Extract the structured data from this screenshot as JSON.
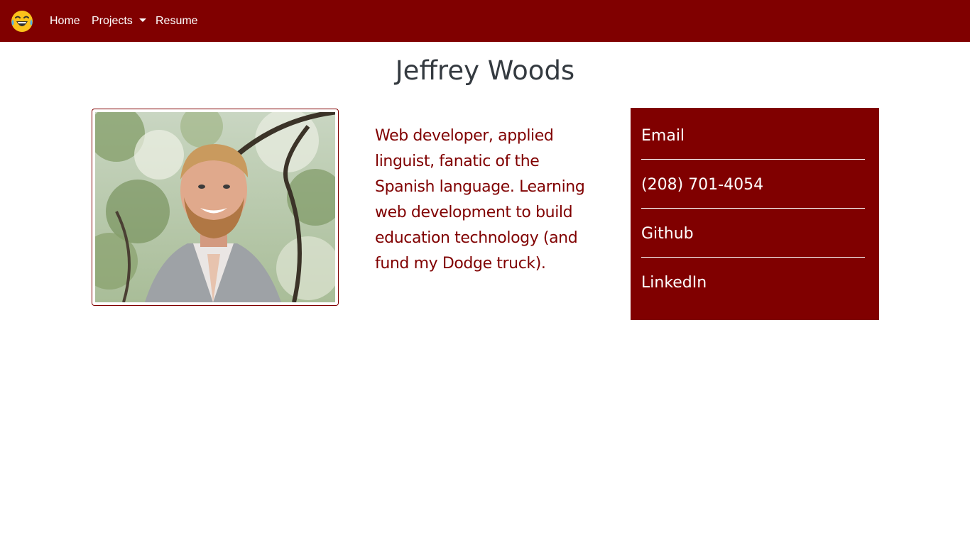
{
  "brand": {
    "icon": "laughing-face-emoji"
  },
  "nav": {
    "home_label": "Home",
    "projects_label": "Projects",
    "resume_label": "Resume"
  },
  "page": {
    "title": "Jeffrey Woods",
    "bio": "Web developer, applied linguist, fanatic of the Spanish language. Learning web development to build education technology (and fund my Dodge truck)."
  },
  "contact": {
    "items": [
      {
        "label": "Email"
      },
      {
        "label": "(208) 701-4054"
      },
      {
        "label": "Github"
      },
      {
        "label": "LinkedIn"
      }
    ]
  },
  "colors": {
    "brand": "#800000",
    "title_text": "#343a40",
    "background": "#ffffff"
  }
}
